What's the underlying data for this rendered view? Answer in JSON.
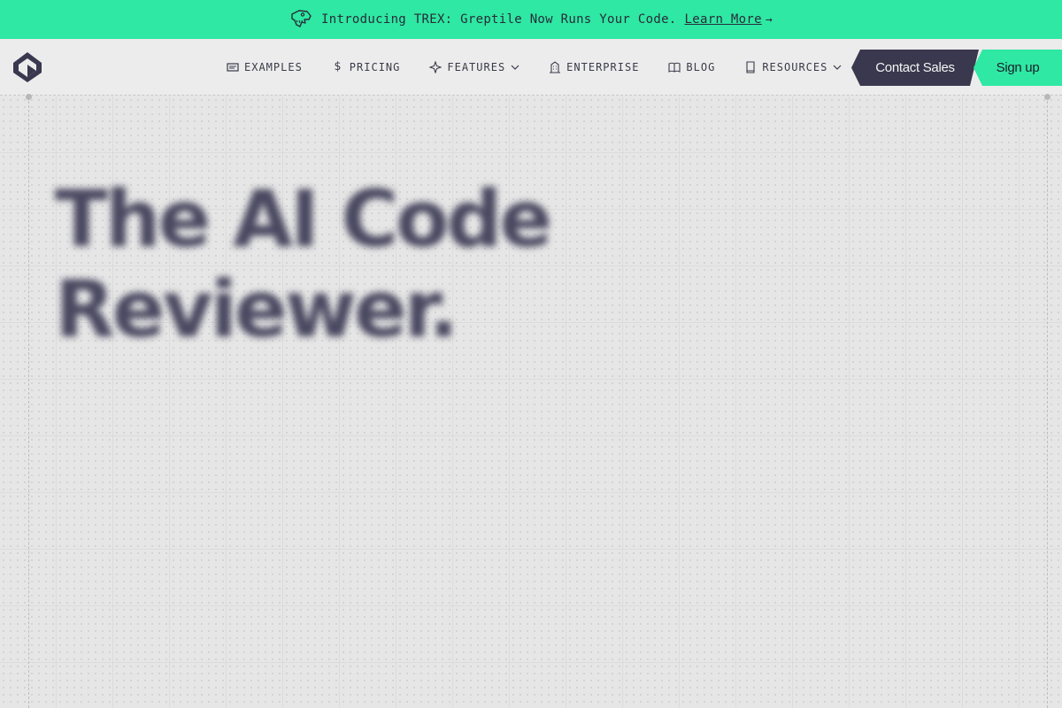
{
  "announcement": {
    "icon": "trex-skull-icon",
    "text": "Introducing TREX: Greptile Now Runs Your Code.",
    "link_label": "Learn More",
    "arrow": "→",
    "color": "#2ee8a3"
  },
  "header": {
    "logo": "greptile-logo-icon",
    "nav": [
      {
        "label": "EXAMPLES",
        "icon": "examples-icon"
      },
      {
        "label": "PRICING",
        "icon": "dollar-icon"
      },
      {
        "label": "FEATURES",
        "icon": "sparkle-icon",
        "dropdown": true
      },
      {
        "label": "ENTERPRISE",
        "icon": "building-icon"
      },
      {
        "label": "BLOG",
        "icon": "book-open-icon"
      },
      {
        "label": "RESOURCES",
        "icon": "book-icon",
        "dropdown": true
      }
    ],
    "contact_label": "Contact Sales",
    "signup_label": "Sign up",
    "contact_color": "#3a384e",
    "signup_color": "#2ee8a3"
  },
  "hero": {
    "title_line1": "The AI Code",
    "title_line2": "Reviewer."
  }
}
